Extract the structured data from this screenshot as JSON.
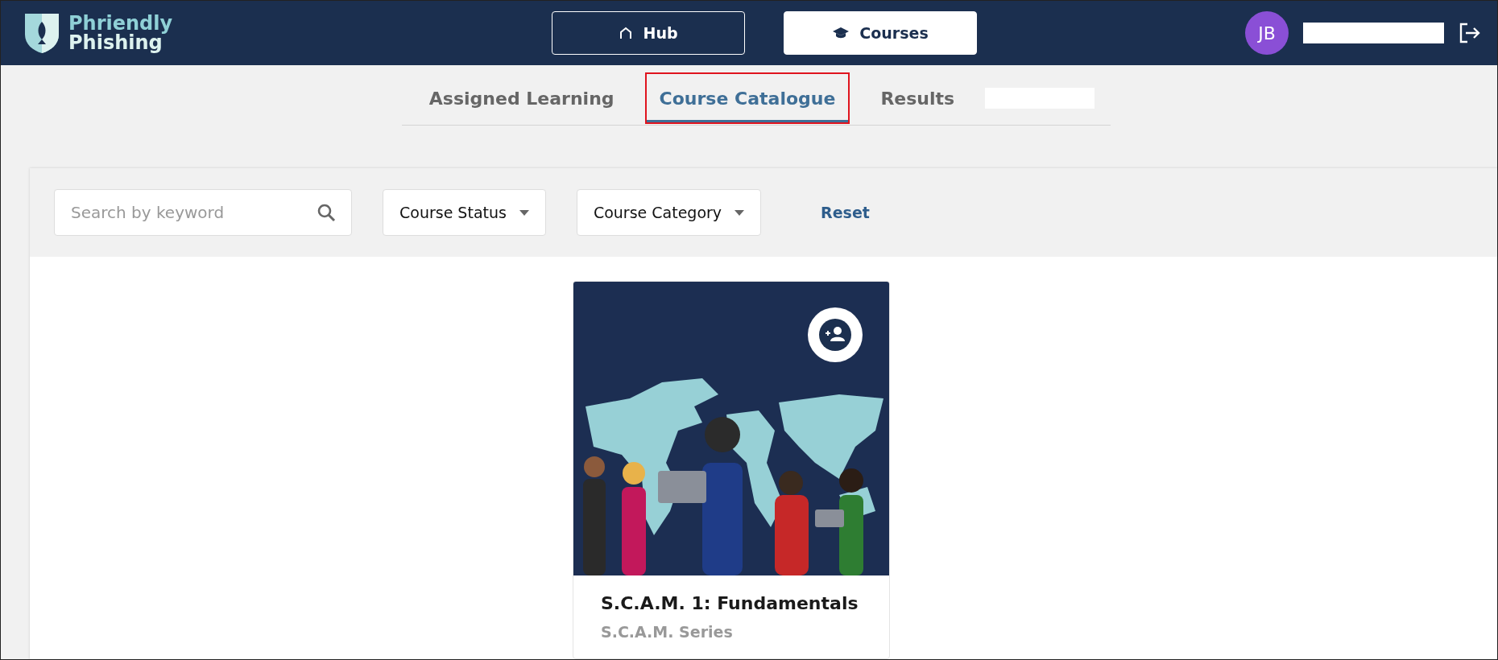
{
  "header": {
    "logo": {
      "line_1": "Phriendly",
      "line_2": "Phishing"
    },
    "nav": [
      {
        "label": "Hub",
        "selected": false
      },
      {
        "label": "Courses",
        "selected": true
      }
    ],
    "user": {
      "initials": "JB",
      "name_redacted": true
    }
  },
  "tabs": [
    {
      "label": "Assigned Learning",
      "selected": false,
      "highlighted": false
    },
    {
      "label": "Course Catalogue",
      "selected": true,
      "highlighted": true
    },
    {
      "label": "Results",
      "selected": false,
      "highlighted": false
    }
  ],
  "tab_redacted": true,
  "filters": {
    "search": {
      "placeholder": "Search by keyword"
    },
    "dropdowns": [
      {
        "label": "Course Status"
      },
      {
        "label": "Course Category"
      }
    ],
    "reset": "Reset"
  },
  "courses": [
    {
      "title": "S.C.A.M. 1: Fundamentals",
      "series": "S.C.A.M. Series"
    }
  ]
}
